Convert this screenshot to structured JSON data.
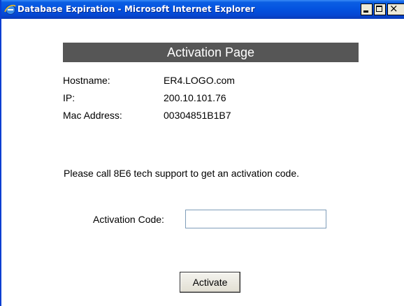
{
  "window": {
    "title": "Database Expiration - Microsoft Internet Explorer",
    "icon": "ie-icon",
    "controls": {
      "minimize": "minimize-icon",
      "maximize": "maximize-icon",
      "close": "×"
    }
  },
  "page": {
    "heading": "Activation Page",
    "info": [
      {
        "label": "Hostname:",
        "value": "ER4.LOGO.com"
      },
      {
        "label": "IP:",
        "value": "200.10.101.76"
      },
      {
        "label": "Mac Address:",
        "value": "00304851B1B7"
      }
    ],
    "message": "Please call 8E6 tech support to get an activation code.",
    "activation_code": {
      "label": "Activation Code:",
      "value": ""
    },
    "activate_button": "Activate"
  },
  "colors": {
    "titlebar": "#0453e0",
    "heading_bar": "#565656"
  }
}
